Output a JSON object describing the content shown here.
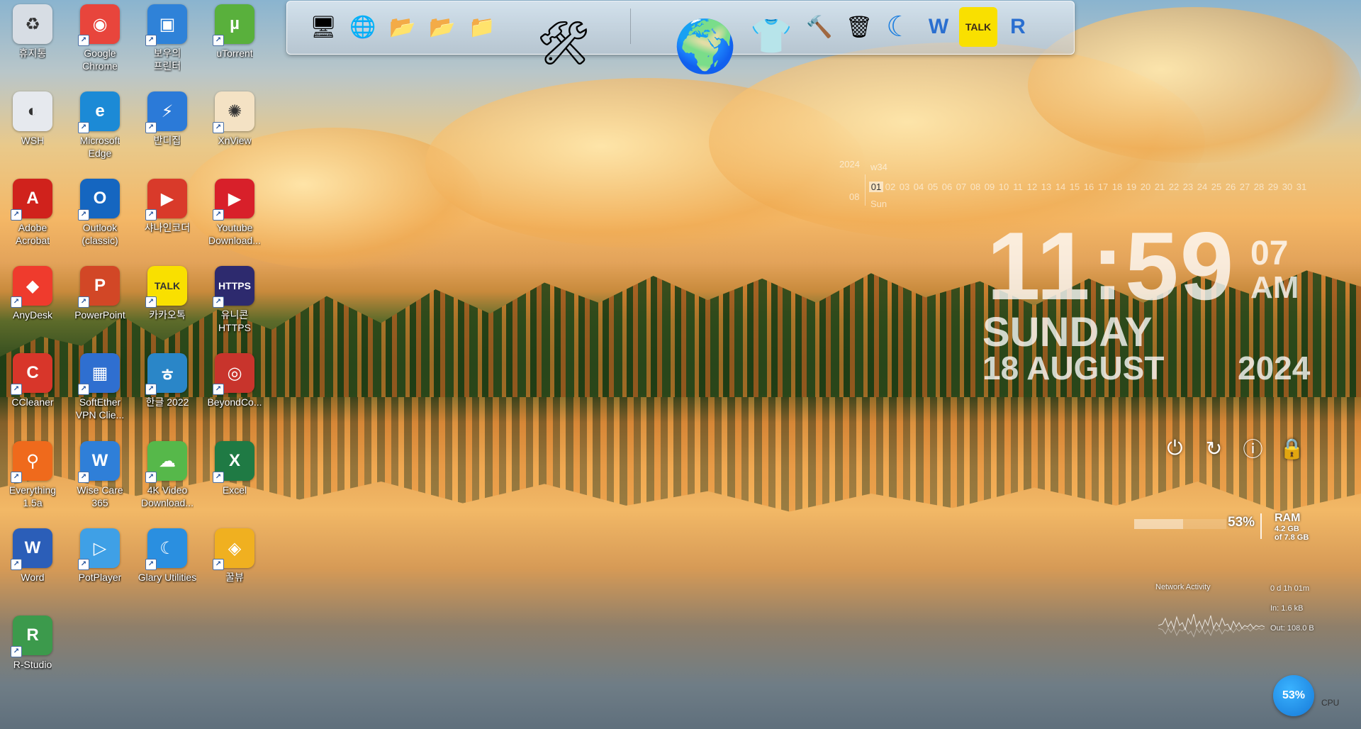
{
  "desktop": {
    "icons": [
      {
        "label": "휴지통",
        "icon": "recycle-bin-icon",
        "color": "#d7dde4",
        "glyph": "♻",
        "shortcut": false
      },
      {
        "label": "Google\nChrome",
        "icon": "chrome-icon",
        "color": "#e8453c",
        "glyph": "◉",
        "shortcut": true
      },
      {
        "label": "보우의\n프린터",
        "icon": "printer-icon",
        "color": "#2f82d8",
        "glyph": "▣",
        "shortcut": true
      },
      {
        "label": "uTorrent",
        "icon": "utorrent-icon",
        "color": "#59b03c",
        "glyph": "µ",
        "shortcut": true
      },
      {
        "label": "WSH",
        "icon": "script-file-icon",
        "color": "#e6e9ee",
        "glyph": "◐",
        "shortcut": false
      },
      {
        "label": "Microsoft\nEdge",
        "icon": "edge-icon",
        "color": "#1c8ad6",
        "glyph": "e",
        "shortcut": true
      },
      {
        "label": "반디집",
        "icon": "bandizip-icon",
        "color": "#2b7ad8",
        "glyph": "⚡",
        "shortcut": true
      },
      {
        "label": "XnView",
        "icon": "xnview-icon",
        "color": "#f4e2c4",
        "glyph": "✺",
        "shortcut": true
      },
      {
        "label": "Adobe\nAcrobat",
        "icon": "acrobat-icon",
        "color": "#d0221c",
        "glyph": "A",
        "shortcut": true
      },
      {
        "label": "Outlook\n(classic)",
        "icon": "outlook-icon",
        "color": "#1566c0",
        "glyph": "O",
        "shortcut": true
      },
      {
        "label": "샤나인코더",
        "icon": "shana-encoder-icon",
        "color": "#d93a2a",
        "glyph": "▶",
        "shortcut": true
      },
      {
        "label": "Youtube\nDownload...",
        "icon": "youtube-downloader-icon",
        "color": "#d8202a",
        "glyph": "▶",
        "shortcut": true
      },
      {
        "label": "AnyDesk",
        "icon": "anydesk-icon",
        "color": "#ef3b2d",
        "glyph": "◆",
        "shortcut": true
      },
      {
        "label": "PowerPoint",
        "icon": "powerpoint-icon",
        "color": "#d24726",
        "glyph": "P",
        "shortcut": true
      },
      {
        "label": "카카오톡",
        "icon": "kakaotalk-icon",
        "color": "#f9e000",
        "glyph": "TALK",
        "shortcut": true
      },
      {
        "label": "유니콘\nHTTPS",
        "icon": "unicorn-https-icon",
        "color": "#2d2a6e",
        "glyph": "HTTPS",
        "shortcut": true
      },
      {
        "label": "CCleaner",
        "icon": "ccleaner-icon",
        "color": "#d8362a",
        "glyph": "C",
        "shortcut": true
      },
      {
        "label": "SoftEther\nVPN Clie...",
        "icon": "softether-vpn-icon",
        "color": "#2f6fd0",
        "glyph": "▦",
        "shortcut": true
      },
      {
        "label": "한글 2022",
        "icon": "hangul-icon",
        "color": "#2a86c8",
        "glyph": "ㅎ",
        "shortcut": true
      },
      {
        "label": "BeyondCo...",
        "icon": "beyond-compare-icon",
        "color": "#c8342c",
        "glyph": "◎",
        "shortcut": true
      },
      {
        "label": "Everything\n1.5a",
        "icon": "everything-search-icon",
        "color": "#ef6a1c",
        "glyph": "⚲",
        "shortcut": true
      },
      {
        "label": "Wise Care\n365",
        "icon": "wise-care-icon",
        "color": "#2f7fd8",
        "glyph": "W",
        "shortcut": true
      },
      {
        "label": "4K Video\nDownload...",
        "icon": "4k-video-downloader-icon",
        "color": "#56b84a",
        "glyph": "☁",
        "shortcut": true
      },
      {
        "label": "Excel",
        "icon": "excel-icon",
        "color": "#1f7a44",
        "glyph": "X",
        "shortcut": true
      },
      {
        "label": "Word",
        "icon": "word-icon",
        "color": "#2b5eb8",
        "glyph": "W",
        "shortcut": true
      },
      {
        "label": "PotPlayer",
        "icon": "potplayer-icon",
        "color": "#3fa0e6",
        "glyph": "▷",
        "shortcut": true
      },
      {
        "label": "Glary Utilities",
        "icon": "glary-utilities-icon",
        "color": "#2a8fe0",
        "glyph": "☾",
        "shortcut": true
      },
      {
        "label": "꿀뷰",
        "icon": "honeyview-icon",
        "color": "#f0b020",
        "glyph": "◈",
        "shortcut": true
      },
      {
        "label": "R-Studio",
        "icon": "r-studio-icon",
        "color": "#3c9a4c",
        "glyph": "R",
        "shortcut": true
      }
    ]
  },
  "dock": {
    "items": [
      {
        "icon": "computer-icon",
        "glyph": "🖥"
      },
      {
        "icon": "network-globe-icon",
        "glyph": "🌐"
      },
      {
        "icon": "folder-icon",
        "glyph": "📂"
      },
      {
        "icon": "shared-folder-icon",
        "glyph": "📂"
      },
      {
        "icon": "drive-folder-icon",
        "glyph": "📁"
      },
      {
        "icon": "system-tools-icon",
        "glyph": "🛠"
      },
      {
        "icon": "globe-icon",
        "glyph": "🌍"
      },
      {
        "icon": "tshirt-icon",
        "glyph": "👕"
      },
      {
        "icon": "tools-icon",
        "glyph": "🔨"
      },
      {
        "icon": "recycle-bin-icon",
        "glyph": "🗑"
      },
      {
        "icon": "glary-moon-icon",
        "glyph": "☾"
      },
      {
        "icon": "wise-shield-icon",
        "glyph": "W"
      },
      {
        "icon": "kakaotalk-icon",
        "glyph": "TALK"
      },
      {
        "icon": "r-studio-icon",
        "glyph": "R"
      }
    ]
  },
  "calendar": {
    "year": "2024",
    "week": "w34",
    "month": "08",
    "weekday": "Sun",
    "days": [
      "01",
      "02",
      "03",
      "04",
      "05",
      "06",
      "07",
      "08",
      "09",
      "10",
      "11",
      "12",
      "13",
      "14",
      "15",
      "16",
      "17",
      "18",
      "19",
      "20",
      "21",
      "22",
      "23",
      "24",
      "25",
      "26",
      "27",
      "28",
      "29",
      "30",
      "31"
    ],
    "highlight_index": 0
  },
  "clock": {
    "time": "11:59",
    "seconds": "07",
    "ampm": "AM",
    "weekday": "SUNDAY",
    "date": "18 AUGUST",
    "year": "2024"
  },
  "power": {
    "buttons": [
      {
        "icon": "power-icon",
        "glyph": "⏻"
      },
      {
        "icon": "restart-icon",
        "glyph": "↻"
      },
      {
        "icon": "info-icon",
        "glyph": "ⓘ"
      },
      {
        "icon": "lock-icon",
        "glyph": "🔒"
      }
    ]
  },
  "ram": {
    "percent_value": 53,
    "percent": "53%",
    "label": "RAM",
    "used": "4.2 GB",
    "total": "of 7.8 GB"
  },
  "network": {
    "title": "Network Activity",
    "uptime": "0 d 1h 01m",
    "in": "In: 1.6 kB",
    "out": "Out: 108.0 B"
  },
  "cpu": {
    "percent": "53%",
    "label": "CPU"
  }
}
